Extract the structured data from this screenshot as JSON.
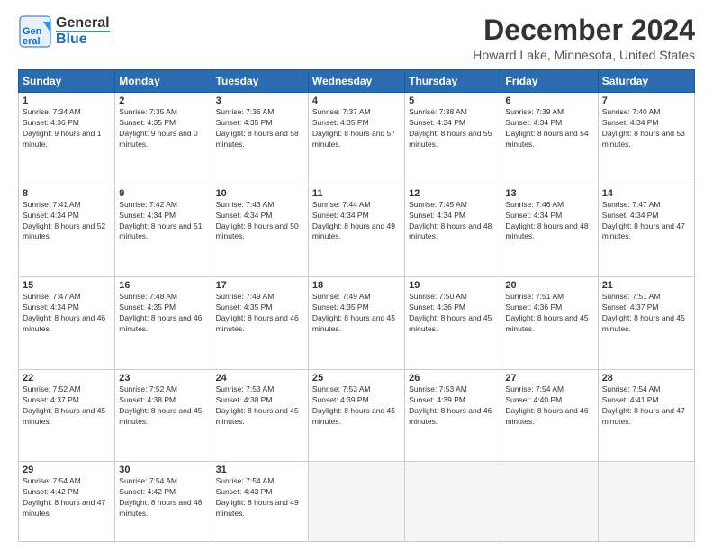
{
  "header": {
    "logo_general": "General",
    "logo_blue": "Blue",
    "title": "December 2024",
    "subtitle": "Howard Lake, Minnesota, United States"
  },
  "calendar": {
    "days_of_week": [
      "Sunday",
      "Monday",
      "Tuesday",
      "Wednesday",
      "Thursday",
      "Friday",
      "Saturday"
    ],
    "weeks": [
      [
        {
          "day": "1",
          "sunrise": "7:34 AM",
          "sunset": "4:36 PM",
          "daylight": "9 hours and 1 minute."
        },
        {
          "day": "2",
          "sunrise": "7:35 AM",
          "sunset": "4:35 PM",
          "daylight": "9 hours and 0 minutes."
        },
        {
          "day": "3",
          "sunrise": "7:36 AM",
          "sunset": "4:35 PM",
          "daylight": "8 hours and 58 minutes."
        },
        {
          "day": "4",
          "sunrise": "7:37 AM",
          "sunset": "4:35 PM",
          "daylight": "8 hours and 57 minutes."
        },
        {
          "day": "5",
          "sunrise": "7:38 AM",
          "sunset": "4:34 PM",
          "daylight": "8 hours and 55 minutes."
        },
        {
          "day": "6",
          "sunrise": "7:39 AM",
          "sunset": "4:34 PM",
          "daylight": "8 hours and 54 minutes."
        },
        {
          "day": "7",
          "sunrise": "7:40 AM",
          "sunset": "4:34 PM",
          "daylight": "8 hours and 53 minutes."
        }
      ],
      [
        {
          "day": "8",
          "sunrise": "7:41 AM",
          "sunset": "4:34 PM",
          "daylight": "8 hours and 52 minutes."
        },
        {
          "day": "9",
          "sunrise": "7:42 AM",
          "sunset": "4:34 PM",
          "daylight": "8 hours and 51 minutes."
        },
        {
          "day": "10",
          "sunrise": "7:43 AM",
          "sunset": "4:34 PM",
          "daylight": "8 hours and 50 minutes."
        },
        {
          "day": "11",
          "sunrise": "7:44 AM",
          "sunset": "4:34 PM",
          "daylight": "8 hours and 49 minutes."
        },
        {
          "day": "12",
          "sunrise": "7:45 AM",
          "sunset": "4:34 PM",
          "daylight": "8 hours and 48 minutes."
        },
        {
          "day": "13",
          "sunrise": "7:46 AM",
          "sunset": "4:34 PM",
          "daylight": "8 hours and 48 minutes."
        },
        {
          "day": "14",
          "sunrise": "7:47 AM",
          "sunset": "4:34 PM",
          "daylight": "8 hours and 47 minutes."
        }
      ],
      [
        {
          "day": "15",
          "sunrise": "7:47 AM",
          "sunset": "4:34 PM",
          "daylight": "8 hours and 46 minutes."
        },
        {
          "day": "16",
          "sunrise": "7:48 AM",
          "sunset": "4:35 PM",
          "daylight": "8 hours and 46 minutes."
        },
        {
          "day": "17",
          "sunrise": "7:49 AM",
          "sunset": "4:35 PM",
          "daylight": "8 hours and 46 minutes."
        },
        {
          "day": "18",
          "sunrise": "7:49 AM",
          "sunset": "4:35 PM",
          "daylight": "8 hours and 45 minutes."
        },
        {
          "day": "19",
          "sunrise": "7:50 AM",
          "sunset": "4:36 PM",
          "daylight": "8 hours and 45 minutes."
        },
        {
          "day": "20",
          "sunrise": "7:51 AM",
          "sunset": "4:36 PM",
          "daylight": "8 hours and 45 minutes."
        },
        {
          "day": "21",
          "sunrise": "7:51 AM",
          "sunset": "4:37 PM",
          "daylight": "8 hours and 45 minutes."
        }
      ],
      [
        {
          "day": "22",
          "sunrise": "7:52 AM",
          "sunset": "4:37 PM",
          "daylight": "8 hours and 45 minutes."
        },
        {
          "day": "23",
          "sunrise": "7:52 AM",
          "sunset": "4:38 PM",
          "daylight": "8 hours and 45 minutes."
        },
        {
          "day": "24",
          "sunrise": "7:53 AM",
          "sunset": "4:38 PM",
          "daylight": "8 hours and 45 minutes."
        },
        {
          "day": "25",
          "sunrise": "7:53 AM",
          "sunset": "4:39 PM",
          "daylight": "8 hours and 45 minutes."
        },
        {
          "day": "26",
          "sunrise": "7:53 AM",
          "sunset": "4:39 PM",
          "daylight": "8 hours and 46 minutes."
        },
        {
          "day": "27",
          "sunrise": "7:54 AM",
          "sunset": "4:40 PM",
          "daylight": "8 hours and 46 minutes."
        },
        {
          "day": "28",
          "sunrise": "7:54 AM",
          "sunset": "4:41 PM",
          "daylight": "8 hours and 47 minutes."
        }
      ],
      [
        {
          "day": "29",
          "sunrise": "7:54 AM",
          "sunset": "4:42 PM",
          "daylight": "8 hours and 47 minutes."
        },
        {
          "day": "30",
          "sunrise": "7:54 AM",
          "sunset": "4:42 PM",
          "daylight": "8 hours and 48 minutes."
        },
        {
          "day": "31",
          "sunrise": "7:54 AM",
          "sunset": "4:43 PM",
          "daylight": "8 hours and 49 minutes."
        },
        null,
        null,
        null,
        null
      ]
    ]
  }
}
